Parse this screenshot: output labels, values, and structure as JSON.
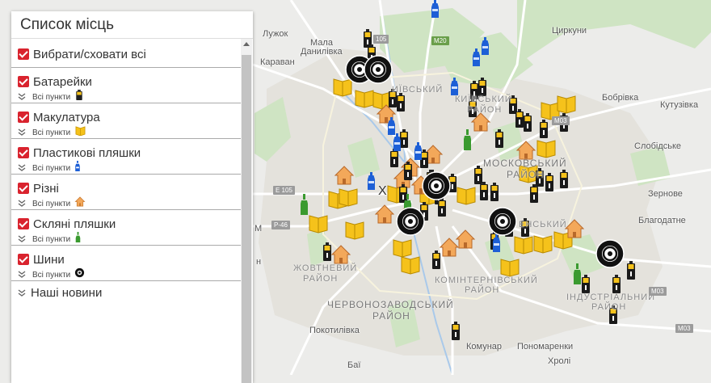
{
  "panel": {
    "title": "Список місць",
    "toggle_all_label": "Вибрати/сховати всі",
    "all_points_label": "Всі пункти",
    "news_label": "Наші новини",
    "categories": [
      {
        "label": "Батарейки",
        "icon": "battery-icon"
      },
      {
        "label": "Макулатура",
        "icon": "paper-icon"
      },
      {
        "label": "Пластикові пляшки",
        "icon": "plastic-bottle-icon"
      },
      {
        "label": "Різні",
        "icon": "house-icon"
      },
      {
        "label": "Скляні пляшки",
        "icon": "glass-bottle-icon"
      },
      {
        "label": "Шини",
        "icon": "tire-icon"
      }
    ]
  },
  "map": {
    "places": {
      "luzhok": "Лужок",
      "mala_danylivka_1": "Мала",
      "mala_danylivka_2": "Данилівка",
      "karavan": "Караван",
      "tsyrkuny": "Циркуни",
      "bobrivka": "Бобрівка",
      "kutuzivka": "Кутузівка",
      "slobidske": "Слобідське",
      "zernove": "Зернове",
      "blahodatne": "Благодатне",
      "pokotylivka": "Покотилівка",
      "komunar": "Комунар",
      "ponomarenky": "Пономаренки",
      "khroli": "Хролі",
      "kh": "Х",
      "bai": "Баї",
      "m": "М",
      "n": "н"
    },
    "districts": {
      "kyivskyi_1": "ИЇВСЬКИЙ",
      "kyivskyi_2": "КИЇВСЬКИЙ",
      "kyivskyi_3": "РАЙОН",
      "moskovskyi_1": "МОСКОВСЬКИЙ",
      "moskovskyi_2": "РАЙОН",
      "nemyshlianskyi": "ЕНСЬКИЙ",
      "zhovtnevyi_1": "ЖОВТНЕВИЙ",
      "zhovtnevyi_2": "РАЙОН",
      "kominternivskyi_1": "КОМІНТЕРНІВСЬКИЙ",
      "kominternivskyi_2": "РАЙОН",
      "chervonozavodskyi_1": "ЧЕРВОНОЗАВОДСЬКИЙ",
      "chervonozavodskyi_2": "РАЙОН",
      "industrialnyi_1": "ІНДУСТРІАЛЬНИЙ",
      "industrialnyi_2": "РАЙОН"
    },
    "roads": {
      "r105": "105",
      "m20": "M20",
      "m03_a": "M03",
      "m03_b": "M03",
      "m03_c": "M03",
      "e105": "E 105",
      "p46": "P-46"
    },
    "colors": {
      "battery": "#f5c21b",
      "paper": "#f5c21b",
      "house": "#f3a85a",
      "plastic": "#1d5fd6",
      "glass": "#3a9a2f",
      "tire": "#111111",
      "check": "#d9232e"
    }
  }
}
